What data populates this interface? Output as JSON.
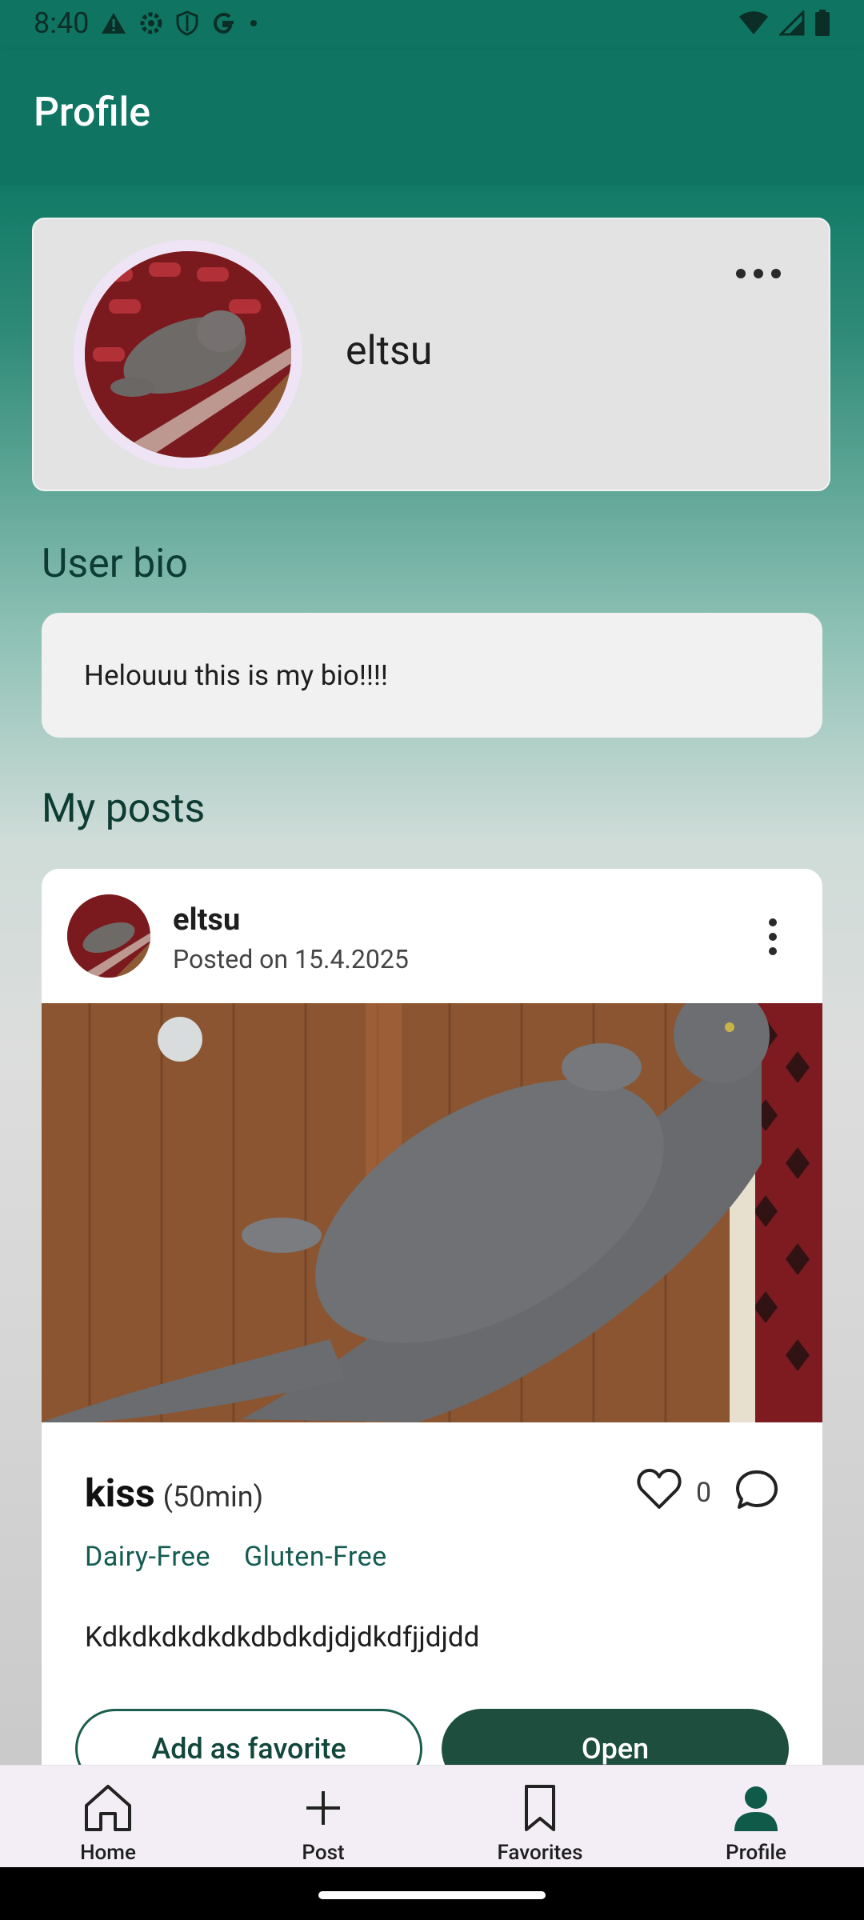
{
  "status_bar": {
    "time": "8:40"
  },
  "app_bar": {
    "title": "Profile"
  },
  "profile": {
    "username": "eltsu"
  },
  "bio": {
    "heading": "User bio",
    "text": "Helouuu this is my bio!!!!"
  },
  "posts": {
    "heading": "My posts",
    "items": [
      {
        "author": "eltsu",
        "date": "Posted on 15.4.2025",
        "title": "kiss",
        "duration": "(50min)",
        "likes": "0",
        "tags": [
          "Dairy-Free",
          "Gluten-Free"
        ],
        "description": "Kdkdkdkdkdkdbdkdjdjdkdfjjdjdd",
        "favorite_label": "Add as favorite",
        "open_label": "Open"
      }
    ]
  },
  "nav": [
    {
      "label": "Home",
      "icon": "home-icon"
    },
    {
      "label": "Post",
      "icon": "plus-icon"
    },
    {
      "label": "Favorites",
      "icon": "bookmark-icon"
    },
    {
      "label": "Profile",
      "icon": "person-icon"
    }
  ],
  "colors": {
    "primary": "#0f7562",
    "dark_green": "#1e4e3d",
    "nav_bg": "#f3eef6"
  }
}
